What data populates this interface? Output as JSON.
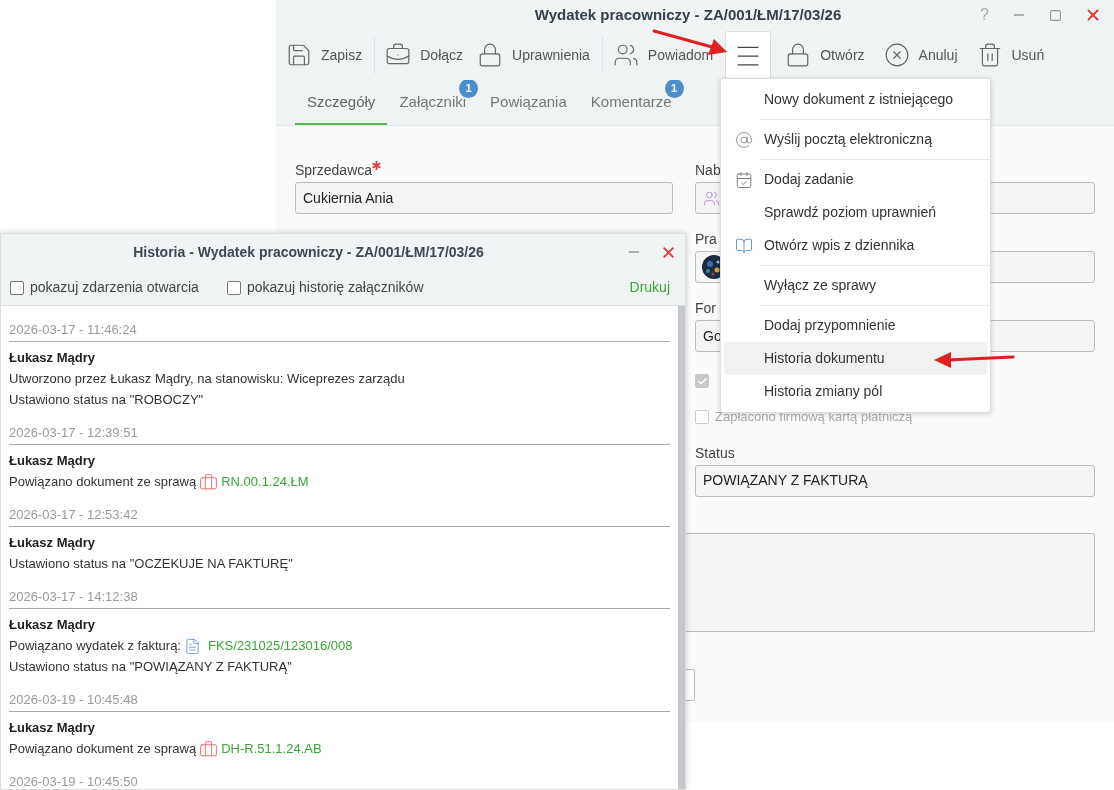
{
  "main_window": {
    "title": "Wydatek pracowniczy - ZA/001/ŁM/17/03/26",
    "help": "?",
    "toolbar": [
      {
        "label": "Zapisz"
      },
      {
        "label": "Dołącz"
      },
      {
        "label": "Uprawnienia"
      },
      {
        "label": "Powiadom"
      },
      {
        "label": "Otwórz"
      },
      {
        "label": "Anuluj"
      },
      {
        "label": "Usuń"
      }
    ],
    "menu_button": {
      "expanded": true
    },
    "tabs": [
      {
        "label": "Szczegóły",
        "selected": true
      },
      {
        "label": "Załączniki",
        "selected": false,
        "badge": "1"
      },
      {
        "label": "Powiązania",
        "selected": false
      },
      {
        "label": "Komentarze",
        "selected": false,
        "badge": "1"
      }
    ],
    "form": {
      "seller": {
        "label": "Sprzedawca",
        "required": true,
        "value": "Cukiernia Ania"
      },
      "field_2": {
        "label": "Nab"
      },
      "field_3": {
        "label": "Pra"
      },
      "field_4": {
        "label": "For",
        "value": "Go"
      },
      "checkboxes": [
        {
          "checked": true,
          "disabled": true
        },
        {
          "label": "Zapłacono firmową kartą płatniczą",
          "checked": false,
          "disabled": true
        }
      ],
      "status": {
        "label": "Status",
        "value": "POWIĄZANY Z FAKTURĄ"
      }
    }
  },
  "menu": {
    "groups": [
      [
        {
          "label": "Nowy dokument z istniejącego",
          "highlighted": false
        }
      ],
      [
        {
          "label": "Wyślij pocztą elektroniczną",
          "highlighted": false
        }
      ],
      [
        {
          "label": "Dodaj zadanie",
          "highlighted": false
        },
        {
          "label": "Sprawdź poziom uprawnień",
          "highlighted": false
        },
        {
          "label": "Otwórz wpis z dziennika",
          "highlighted": false
        }
      ],
      [
        {
          "label": "Wyłącz ze sprawy",
          "highlighted": false
        }
      ],
      [
        {
          "label": "Dodaj przypomnienie",
          "highlighted": false
        },
        {
          "label": "Historia dokumentu",
          "highlighted": true
        },
        {
          "label": "Historia zmiany pól",
          "highlighted": false
        }
      ]
    ]
  },
  "history_window": {
    "title": "Historia - Wydatek pracowniczy - ZA/001/ŁM/17/03/26",
    "options": [
      {
        "label": "pokazuj zdarzenia otwarcia",
        "checked": false
      },
      {
        "label": "pokazuj historię załączników",
        "checked": false
      }
    ],
    "print": "Drukuj",
    "entries": [
      {
        "time": "2026-03-17 - 11:46:24",
        "author": "Łukasz Mądry",
        "lines": [
          {
            "text": "Utworzono przez Łukasz Mądry, na stanowisku: Wiceprezes zarządu"
          },
          {
            "text": "Ustawiono status na \"ROBOCZY\""
          }
        ]
      },
      {
        "time": "2026-03-17 - 12:39:51",
        "author": "Łukasz Mądry",
        "lines": [
          {
            "text": "Powiązano dokument ze sprawą",
            "link": {
              "kind": "case",
              "label": "RN.00.1.24.ŁM"
            }
          }
        ]
      },
      {
        "time": "2026-03-17 - 12:53:42",
        "author": "Łukasz Mądry",
        "lines": [
          {
            "text": "Ustawiono status na \"OCZEKUJE NA FAKTURĘ\""
          }
        ]
      },
      {
        "time": "2026-03-17 - 14:12:38",
        "author": "Łukasz Mądry",
        "lines": [
          {
            "text": "Powiązano wydatek z fakturą:",
            "link": {
              "kind": "invoice",
              "label": "FKS/231025/123016/008"
            }
          },
          {
            "text": "Ustawiono status na \"POWIĄZANY Z FAKTURĄ\""
          }
        ]
      },
      {
        "time": "2026-03-19 - 10:45:48",
        "author": "Łukasz Mądry",
        "lines": [
          {
            "text": "Powiązano dokument ze sprawą",
            "link": {
              "kind": "case",
              "label": "DH-R.51.1.24.AB"
            }
          }
        ]
      },
      {
        "time": "2026-03-19 - 10:45:50"
      }
    ]
  }
}
